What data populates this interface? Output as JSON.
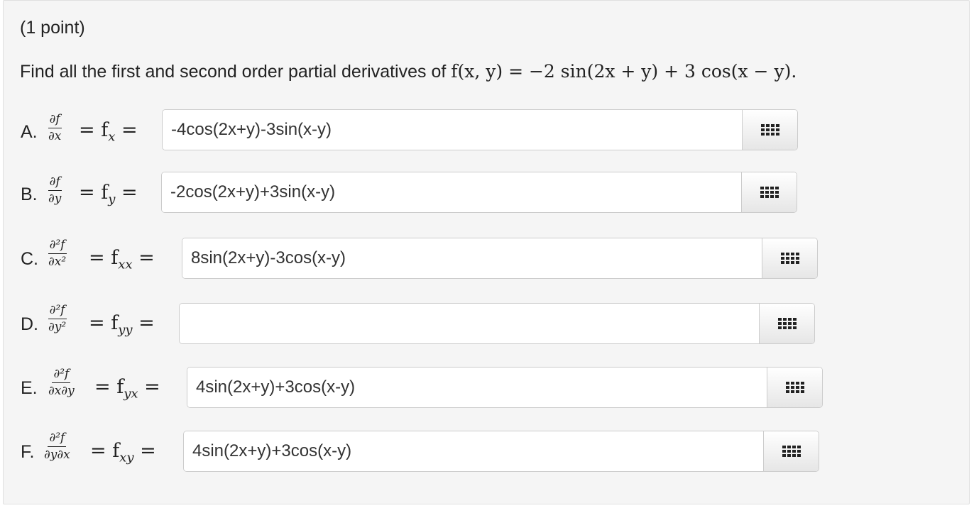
{
  "problem": {
    "points": "(1 point)",
    "prompt_text": "Find all the first and second order partial derivatives of ",
    "prompt_math": "f(x, y) = −2 sin(2x + y) + 3 cos(x − y).",
    "icon": "grid-icon"
  },
  "parts": [
    {
      "label": "A.",
      "num": "∂f",
      "den": "∂x",
      "eq": "= f",
      "sub": "x",
      "eq_end": " =",
      "value": "-4cos(2x+y)-3sin(x-y)"
    },
    {
      "label": "B.",
      "num": "∂f",
      "den": "∂y",
      "eq": "= f",
      "sub": "y",
      "eq_end": " =",
      "value": "-2cos(2x+y)+3sin(x-y)"
    },
    {
      "label": "C.",
      "num": "∂²f",
      "den": "∂x²",
      "eq": "= f",
      "sub": "xx",
      "eq_end": " =",
      "value": "8sin(2x+y)-3cos(x-y)"
    },
    {
      "label": "D.",
      "num": "∂²f",
      "den": "∂y²",
      "eq": "= f",
      "sub": "yy",
      "eq_end": " =",
      "value": ""
    },
    {
      "label": "E.",
      "num": "∂²f",
      "den": "∂x∂y",
      "eq": "= f",
      "sub": "yx",
      "eq_end": " =",
      "value": "4sin(2x+y)+3cos(x-y)"
    },
    {
      "label": "F.",
      "num": "∂²f",
      "den": "∂y∂x",
      "eq": "= f",
      "sub": "xy",
      "eq_end": " =",
      "value": "4sin(2x+y)+3cos(x-y)"
    }
  ]
}
